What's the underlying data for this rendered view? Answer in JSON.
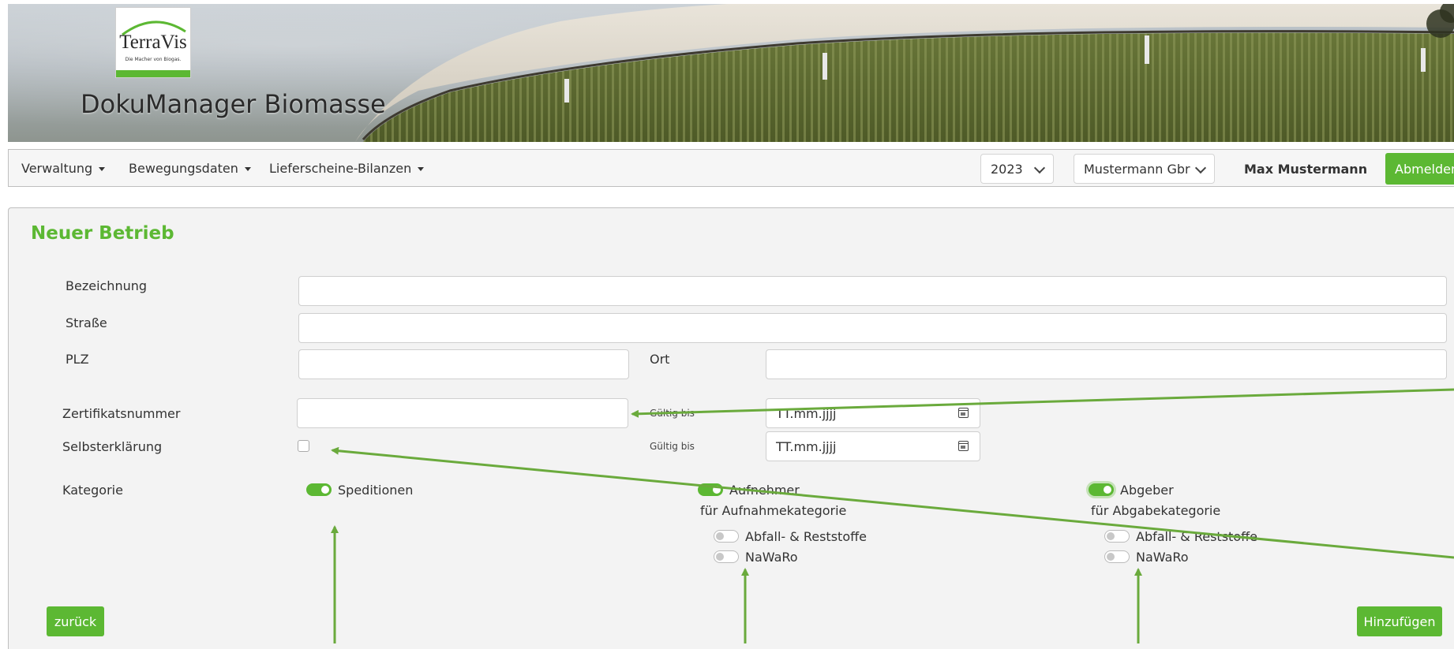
{
  "header": {
    "logo_text": "TerraVis",
    "logo_tagline": "Die Macher von Biogas.",
    "app_title": "DokuManager Biomasse"
  },
  "navbar": {
    "menus": [
      "Verwaltung",
      "Bewegungsdaten",
      "Lieferscheine-Bilanzen"
    ],
    "year_select": "2023",
    "company_select": "Mustermann Gbr",
    "user_name": "Max Mustermann",
    "logout_label": "Abmelden"
  },
  "form": {
    "title": "Neuer Betrieb",
    "labels": {
      "bezeichnung": "Bezeichnung",
      "strasse": "Straße",
      "plz": "PLZ",
      "ort": "Ort",
      "zertifikatsnummer": "Zertifikatsnummer",
      "gueltig_bis_1": "Gültig bis",
      "selbsterklaerung": "Selbsterklärung",
      "gueltig_bis_2": "Gültig bis",
      "kategorie": "Kategorie"
    },
    "values": {
      "bezeichnung": "",
      "strasse": "",
      "plz": "",
      "ort": "",
      "zertifikatsnummer": ""
    },
    "date_placeholder": "TT.mm.jjjj",
    "toggles": {
      "speditionen": {
        "label": "Speditionen",
        "on": true
      },
      "aufnehmer": {
        "label": "Aufnehmer",
        "on": true,
        "sub_label": "für Aufnahmekategorie"
      },
      "abgeber": {
        "label": "Abgeber",
        "on": true,
        "sub_label": "für Abgabekategorie"
      },
      "auf_abfall": {
        "label": "Abfall- & Reststoffe",
        "on": false
      },
      "auf_nawaro": {
        "label": "NaWaRo",
        "on": false
      },
      "abg_abfall": {
        "label": "Abfall- & Reststoffe",
        "on": false
      },
      "abg_nawaro": {
        "label": "NaWaRo",
        "on": false
      }
    },
    "back_label": "zurück",
    "add_label": "Hinzufügen"
  },
  "colors": {
    "accent": "#5cb833",
    "annotation": "#6aaa3c"
  }
}
